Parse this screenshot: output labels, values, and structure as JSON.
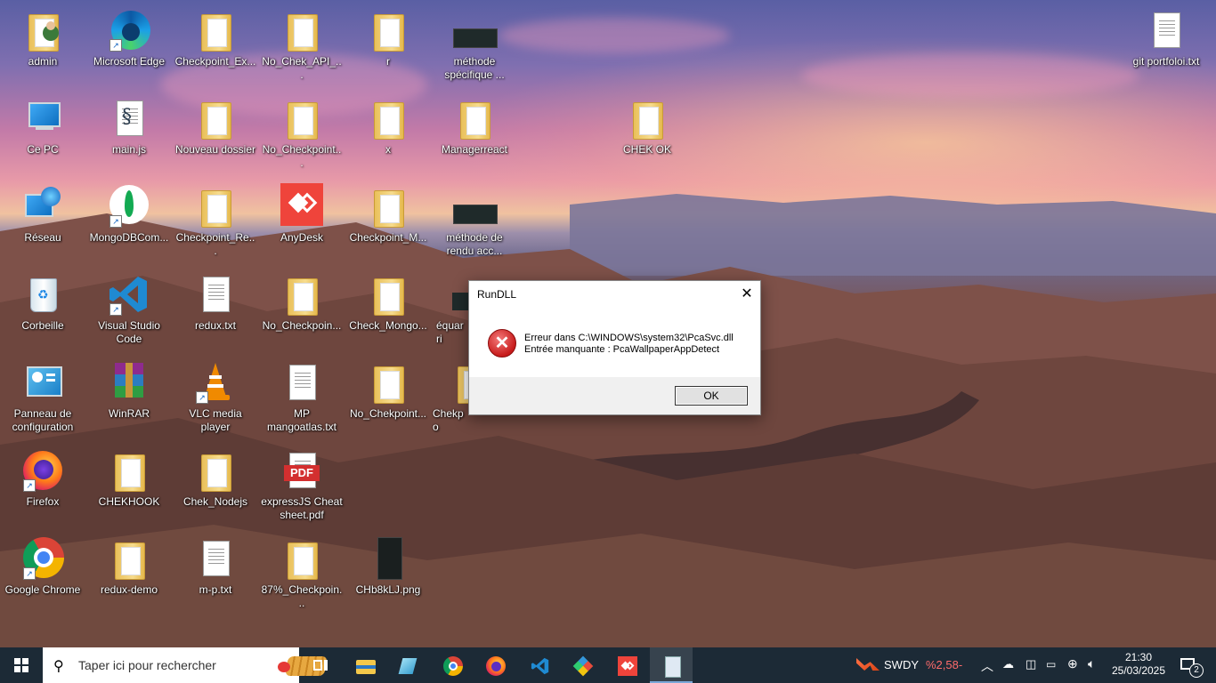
{
  "desktop_icons": [
    {
      "label": "admin",
      "kind": "user"
    },
    {
      "label": "Microsoft Edge",
      "kind": "edge"
    },
    {
      "label": "Checkpoint_Ex...",
      "kind": "folder"
    },
    {
      "label": "No_Chek_API_...",
      "kind": "folder"
    },
    {
      "label": "r",
      "kind": "folder"
    },
    {
      "label": "méthode spécifique ...",
      "kind": "image"
    },
    {
      "label": "git portfoloi.txt",
      "kind": "doc"
    },
    {
      "label": "Ce PC",
      "kind": "pc"
    },
    {
      "label": "main.js",
      "kind": "js"
    },
    {
      "label": "Nouveau dossier",
      "kind": "folder"
    },
    {
      "label": "No_Checkpoint...",
      "kind": "folder"
    },
    {
      "label": "x",
      "kind": "folder"
    },
    {
      "label": "Managerreact",
      "kind": "folder"
    },
    {
      "label": "CHEK OK",
      "kind": "folder"
    },
    {
      "label": "Réseau",
      "kind": "network"
    },
    {
      "label": "MongoDBCom...",
      "kind": "mongodb"
    },
    {
      "label": "Checkpoint_Re...",
      "kind": "folder"
    },
    {
      "label": "AnyDesk",
      "kind": "anydesk"
    },
    {
      "label": "Checkpoint_M...",
      "kind": "folder"
    },
    {
      "label": "méthode de rendu acc...",
      "kind": "image"
    },
    {
      "label": "Corbeille",
      "kind": "recycle"
    },
    {
      "label": "Visual Studio Code",
      "kind": "vscode"
    },
    {
      "label": "redux.txt",
      "kind": "doc"
    },
    {
      "label": "No_Checkpoin...",
      "kind": "folder"
    },
    {
      "label": "Check_Mongo...",
      "kind": "folder"
    },
    {
      "label": "équarri",
      "kind": "image"
    },
    {
      "label": "Panneau de configuration",
      "kind": "controlpanel"
    },
    {
      "label": "WinRAR",
      "kind": "winrar"
    },
    {
      "label": "VLC media player",
      "kind": "vlc"
    },
    {
      "label": "MP mangoatlas.txt",
      "kind": "doc"
    },
    {
      "label": "No_Chekpoint...",
      "kind": "folder"
    },
    {
      "label": "Chekpo",
      "kind": "folder"
    },
    {
      "label": "Firefox",
      "kind": "firefox"
    },
    {
      "label": "CHEKHOOK",
      "kind": "folder"
    },
    {
      "label": "Chek_Nodejs",
      "kind": "folder"
    },
    {
      "label": "expressJS Cheat sheet.pdf",
      "kind": "pdf"
    },
    {
      "label": "Google Chrome",
      "kind": "chrome"
    },
    {
      "label": "redux-demo",
      "kind": "folder"
    },
    {
      "label": "m-p.txt",
      "kind": "doc"
    },
    {
      "label": "87%_Checkpoin...",
      "kind": "folder"
    },
    {
      "label": "CHb8kLJ.png",
      "kind": "image"
    }
  ],
  "dialog": {
    "title": "RunDLL",
    "close_label": "✕",
    "line1": "Erreur dans C:\\WINDOWS\\system32\\PcaSvc.dll",
    "line2": "Entrée manquante : PcaWallpaperAppDetect",
    "ok_label": "OK"
  },
  "taskbar": {
    "search_placeholder": "Taper ici pour rechercher",
    "apps": [
      "task-view",
      "file-explorer",
      "notepad-like",
      "google-chrome",
      "firefox",
      "visual-studio-code",
      "git-extension",
      "anydesk",
      "notepad"
    ],
    "stock_symbol": "SWDY",
    "stock_change": "%2,58-",
    "time": "21:30",
    "date": "25/03/2025",
    "notification_count": "2"
  }
}
